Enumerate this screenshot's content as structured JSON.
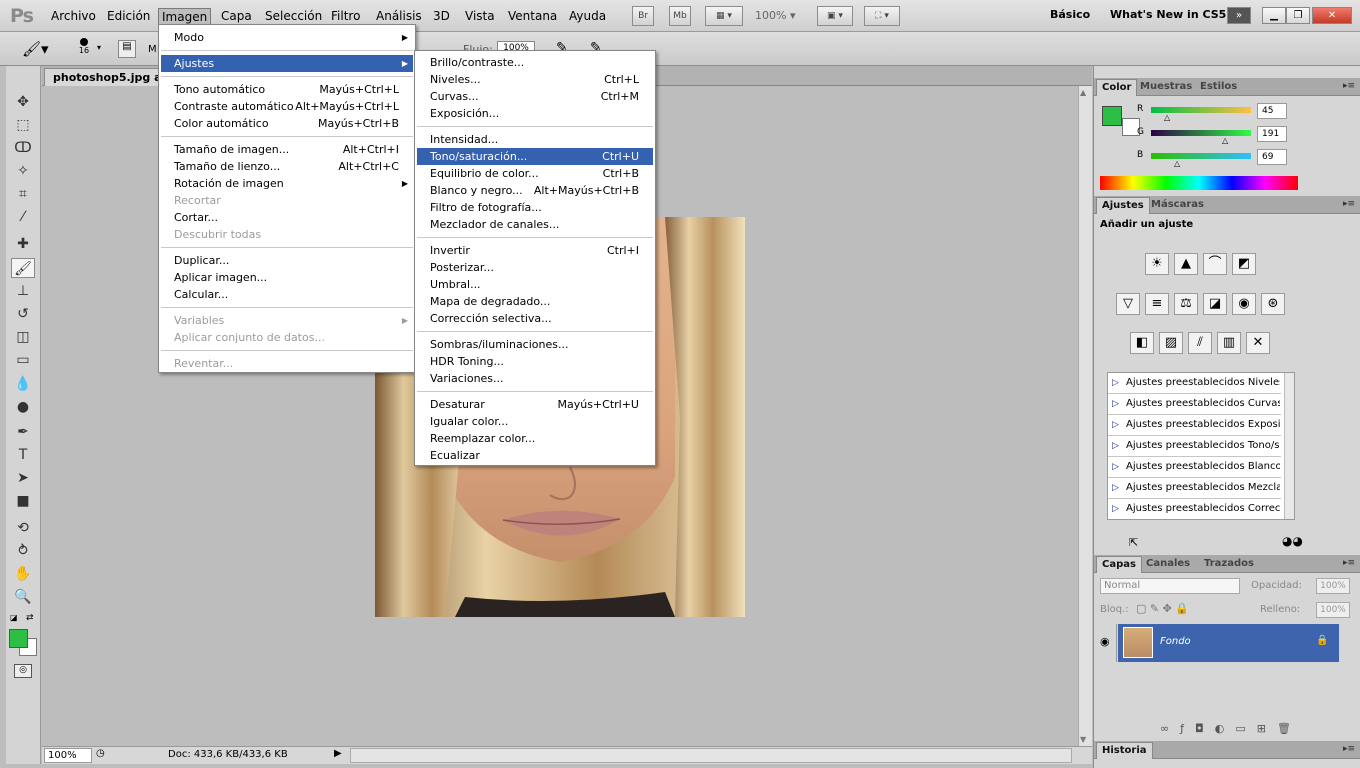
{
  "app": {
    "logo": "Ps"
  },
  "menubar": {
    "items": [
      "Archivo",
      "Edición",
      "Imagen",
      "Capa",
      "Selección",
      "Filtro",
      "Análisis",
      "3D",
      "Vista",
      "Ventana",
      "Ayuda"
    ],
    "br": "Br",
    "mb": "Mb",
    "zoom": "100%",
    "workspace_basic": "Básico",
    "workspace_new": "What's New in CS5"
  },
  "options": {
    "brush_size": "16",
    "flow_label": "Flujo:",
    "flow_value": "100%"
  },
  "document": {
    "tab_title": "photoshop5.jpg al",
    "zoom": "100%",
    "doc_info": "Doc: 433,6 KB/433,6 KB"
  },
  "imagen_menu": [
    {
      "label": "Modo",
      "shortcut": "",
      "sub": true
    },
    {
      "sep": true
    },
    {
      "label": "Ajustes",
      "shortcut": "",
      "sub": true,
      "hl": true
    },
    {
      "sep": true
    },
    {
      "label": "Tono automático",
      "shortcut": "Mayús+Ctrl+L"
    },
    {
      "label": "Contraste automático",
      "shortcut": "Alt+Mayús+Ctrl+L"
    },
    {
      "label": "Color automático",
      "shortcut": "Mayús+Ctrl+B"
    },
    {
      "sep": true
    },
    {
      "label": "Tamaño de imagen...",
      "shortcut": "Alt+Ctrl+I"
    },
    {
      "label": "Tamaño de lienzo...",
      "shortcut": "Alt+Ctrl+C"
    },
    {
      "label": "Rotación de imagen",
      "shortcut": "",
      "sub": true
    },
    {
      "label": "Recortar",
      "shortcut": "",
      "dis": true
    },
    {
      "label": "Cortar...",
      "shortcut": ""
    },
    {
      "label": "Descubrir todas",
      "shortcut": "",
      "dis": true
    },
    {
      "sep": true
    },
    {
      "label": "Duplicar...",
      "shortcut": ""
    },
    {
      "label": "Aplicar imagen...",
      "shortcut": ""
    },
    {
      "label": "Calcular...",
      "shortcut": ""
    },
    {
      "sep": true
    },
    {
      "label": "Variables",
      "shortcut": "",
      "sub": true,
      "dis": true
    },
    {
      "label": "Aplicar conjunto de datos...",
      "shortcut": "",
      "dis": true
    },
    {
      "sep": true
    },
    {
      "label": "Reventar...",
      "shortcut": "",
      "dis": true
    }
  ],
  "ajustes_menu": [
    {
      "label": "Brillo/contraste...",
      "shortcut": ""
    },
    {
      "label": "Niveles...",
      "shortcut": "Ctrl+L"
    },
    {
      "label": "Curvas...",
      "shortcut": "Ctrl+M"
    },
    {
      "label": "Exposición...",
      "shortcut": ""
    },
    {
      "sep": true
    },
    {
      "label": "Intensidad...",
      "shortcut": ""
    },
    {
      "label": "Tono/saturación...",
      "shortcut": "Ctrl+U",
      "hl": true
    },
    {
      "label": "Equilibrio de color...",
      "shortcut": "Ctrl+B"
    },
    {
      "label": "Blanco y negro...",
      "shortcut": "Alt+Mayús+Ctrl+B"
    },
    {
      "label": "Filtro de fotografía...",
      "shortcut": ""
    },
    {
      "label": "Mezclador de canales...",
      "shortcut": ""
    },
    {
      "sep": true
    },
    {
      "label": "Invertir",
      "shortcut": "Ctrl+I"
    },
    {
      "label": "Posterizar...",
      "shortcut": ""
    },
    {
      "label": "Umbral...",
      "shortcut": ""
    },
    {
      "label": "Mapa de degradado...",
      "shortcut": ""
    },
    {
      "label": "Corrección selectiva...",
      "shortcut": ""
    },
    {
      "sep": true
    },
    {
      "label": "Sombras/iluminaciones...",
      "shortcut": ""
    },
    {
      "label": "HDR Toning...",
      "shortcut": ""
    },
    {
      "label": "Variaciones...",
      "shortcut": ""
    },
    {
      "sep": true
    },
    {
      "label": "Desaturar",
      "shortcut": "Mayús+Ctrl+U"
    },
    {
      "label": "Igualar color...",
      "shortcut": ""
    },
    {
      "label": "Reemplazar color...",
      "shortcut": ""
    },
    {
      "label": "Ecualizar",
      "shortcut": ""
    }
  ],
  "color_panel": {
    "tabs": [
      "Color",
      "Muestras",
      "Estilos"
    ],
    "r_label": "R",
    "g_label": "G",
    "b_label": "B",
    "r": "45",
    "g": "191",
    "b": "69",
    "foreground": "#2dbf45"
  },
  "ajustes_panel": {
    "tabs": [
      "Ajustes",
      "Máscaras"
    ],
    "heading": "Añadir un ajuste",
    "presets": [
      "Ajustes preestablecidos Niveles",
      "Ajustes preestablecidos Curvas",
      "Ajustes preestablecidos Exposición",
      "Ajustes preestablecidos Tono/saturación",
      "Ajustes preestablecidos Blanco y negro",
      "Ajustes preestablecidos Mezclador de canales",
      "Ajustes preestablecidos Corrección selectiva"
    ]
  },
  "capas_panel": {
    "tabs": [
      "Capas",
      "Canales",
      "Trazados"
    ],
    "blend_mode": "Normal",
    "opacity_label": "Opacidad:",
    "opacity": "100%",
    "lock_label": "Bloq.:",
    "fill_label": "Relleno:",
    "fill": "100%",
    "layer_name": "Fondo"
  },
  "historia_panel": {
    "title": "Historia"
  }
}
